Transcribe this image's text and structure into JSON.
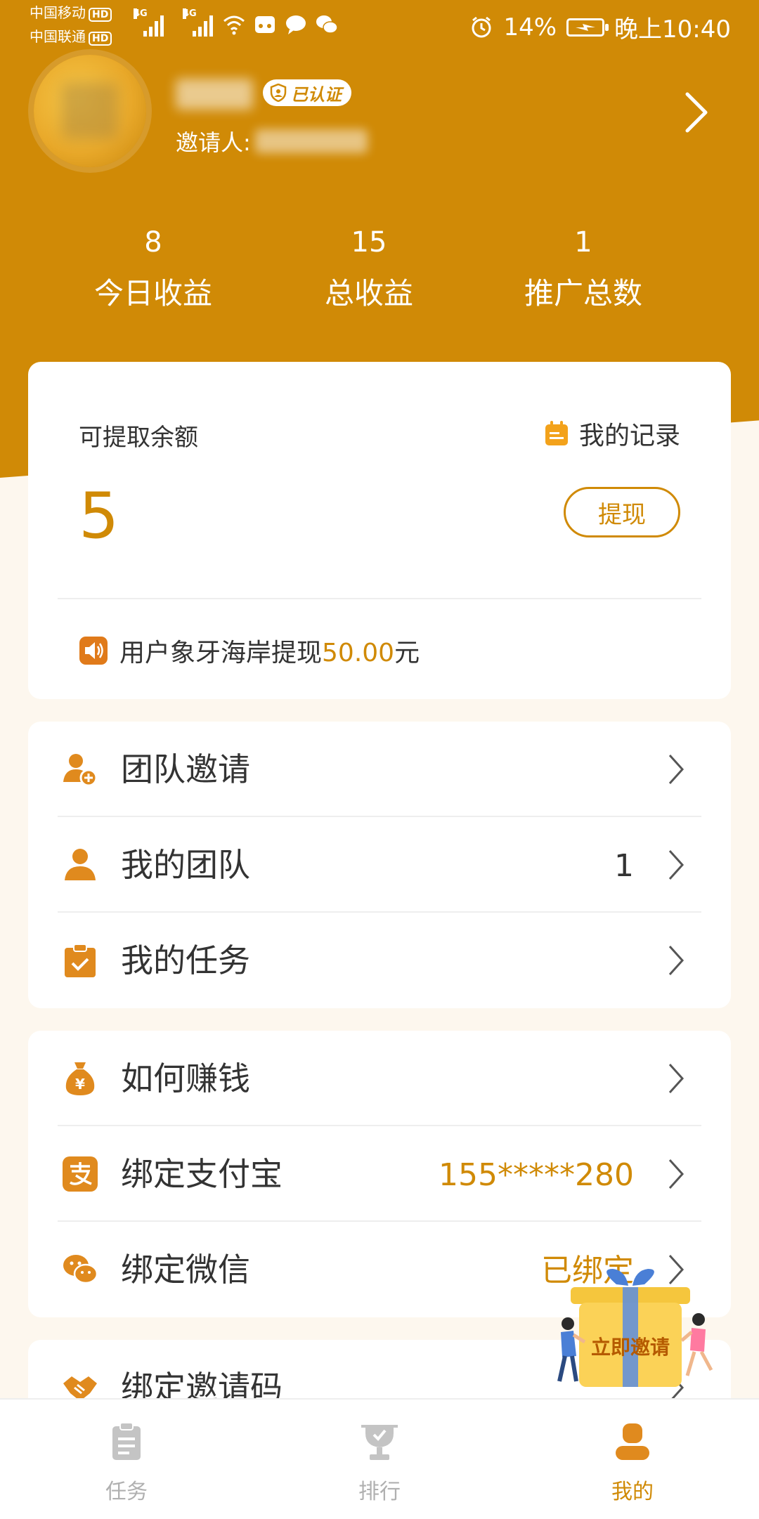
{
  "status_bar": {
    "carrier1": "中国移动",
    "carrier2": "中国联通",
    "hd_badge": "HD",
    "network1": "4G",
    "network2": "4G",
    "battery": "14%",
    "time": "晚上10:40"
  },
  "profile": {
    "verified_badge": "已认证",
    "inviter_label": "邀请人:"
  },
  "stats": [
    {
      "value": "8",
      "label": "今日收益"
    },
    {
      "value": "15",
      "label": "总收益"
    },
    {
      "value": "1",
      "label": "推广总数"
    }
  ],
  "balance": {
    "label": "可提取余额",
    "record_label": "我的记录",
    "value": "5",
    "withdraw_button": "提现",
    "notice_prefix": "用户象牙海岸提现",
    "notice_amount": "50.00",
    "notice_suffix": "元"
  },
  "menu_group1": [
    {
      "label": "团队邀请",
      "value": ""
    },
    {
      "label": "我的团队",
      "value": "1"
    },
    {
      "label": "我的任务",
      "value": ""
    }
  ],
  "menu_group2": [
    {
      "label": "如何赚钱",
      "value": ""
    },
    {
      "label": "绑定支付宝",
      "value": "155*****280"
    },
    {
      "label": "绑定微信",
      "value": "已绑定"
    }
  ],
  "menu_group3": [
    {
      "label": "绑定邀请码",
      "value": ""
    }
  ],
  "float_invite": {
    "label": "立即邀请"
  },
  "bottom_nav": [
    {
      "label": "任务",
      "active": false
    },
    {
      "label": "排行",
      "active": false
    },
    {
      "label": "我的",
      "active": true
    }
  ],
  "colors": {
    "primary": "#d08a06",
    "inactive": "#b0b0b0"
  }
}
